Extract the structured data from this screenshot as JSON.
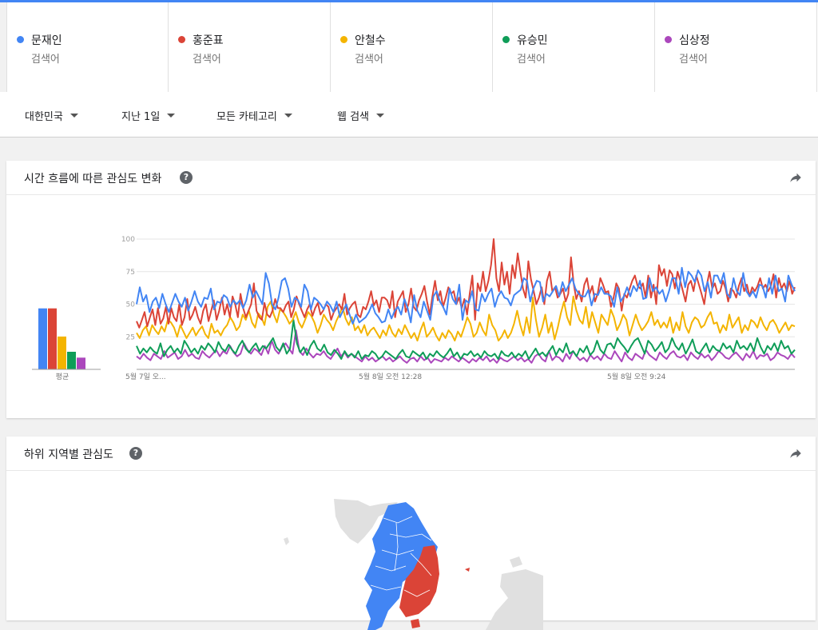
{
  "terms": [
    {
      "name": "문재인",
      "sub": "검색어",
      "color": "#4285f4"
    },
    {
      "name": "홍준표",
      "sub": "검색어",
      "color": "#db4437"
    },
    {
      "name": "안철수",
      "sub": "검색어",
      "color": "#f4b400"
    },
    {
      "name": "유승민",
      "sub": "검색어",
      "color": "#0f9d58"
    },
    {
      "name": "심상정",
      "sub": "검색어",
      "color": "#ab47bc"
    }
  ],
  "filters": {
    "region": "대한민국",
    "time": "지난 1일",
    "category": "모든 카테고리",
    "search_type": "웹 검색"
  },
  "interest_card": {
    "title": "시간 흐름에 따른 관심도 변화"
  },
  "region_card": {
    "title": "하위 지역별 관심도"
  },
  "help_glyph": "?",
  "chart_data": {
    "type": "line",
    "y_ticks": [
      100,
      75,
      50,
      25
    ],
    "ylim": [
      0,
      100
    ],
    "x_tick_labels": [
      "5월 7일 오...",
      "5월 8일 오전 12:28",
      "5월 8일 오전 9:24"
    ],
    "average_label": "평균",
    "averages": [
      {
        "name": "문재인",
        "value": 52
      },
      {
        "name": "홍준표",
        "value": 52
      },
      {
        "name": "안철수",
        "value": 28
      },
      {
        "name": "유승민",
        "value": 15
      },
      {
        "name": "심상정",
        "value": 10
      }
    ],
    "series": [
      {
        "name": "문재인",
        "color": "#4285f4",
        "values": [
          50,
          63,
          52,
          57,
          44,
          52,
          55,
          47,
          58,
          50,
          44,
          51,
          58,
          52,
          48,
          55,
          45,
          52,
          60,
          52,
          48,
          55,
          54,
          62,
          46,
          52,
          51,
          57,
          55,
          48,
          53,
          50,
          53,
          47,
          53,
          65,
          55,
          60,
          55,
          50,
          74,
          66,
          50,
          46,
          55,
          68,
          70,
          62,
          48,
          55,
          53,
          48,
          65,
          60,
          46,
          55,
          53,
          50,
          46,
          52,
          49,
          44,
          52,
          40,
          45,
          50,
          42,
          35,
          42,
          36,
          38,
          40,
          44,
          50,
          43,
          40,
          36,
          37,
          46,
          39,
          45,
          48,
          42,
          54,
          47,
          36,
          57,
          45,
          40,
          52,
          45,
          38,
          56,
          60,
          52,
          48,
          42,
          62,
          54,
          50,
          65,
          38,
          53,
          51,
          60,
          46,
          45,
          58,
          52,
          58,
          62,
          48,
          56,
          60,
          55,
          54,
          49,
          57,
          59,
          61,
          70,
          68,
          52,
          62,
          68,
          67,
          52,
          58,
          56,
          60,
          64,
          56,
          67,
          60,
          65,
          70,
          62,
          58,
          56,
          56,
          61,
          49,
          58,
          57,
          63,
          58,
          58,
          56,
          48,
          63,
          52,
          56,
          63,
          56,
          64,
          60,
          68,
          54,
          55,
          70,
          60,
          63,
          58,
          61,
          52,
          60,
          70,
          70,
          58,
          78,
          63,
          75,
          72,
          67,
          76,
          72,
          60,
          67,
          55,
          72,
          72,
          66,
          74,
          58,
          55,
          70,
          60,
          57,
          74,
          60,
          56,
          60,
          55,
          65,
          64,
          55,
          70,
          58,
          72,
          60,
          62,
          52,
          72,
          65,
          60
        ]
      },
      {
        "name": "홍준표",
        "color": "#db4437",
        "values": [
          37,
          32,
          38,
          44,
          33,
          40,
          46,
          34,
          47,
          35,
          39,
          48,
          35,
          47,
          40,
          37,
          50,
          34,
          40,
          54,
          38,
          42,
          48,
          40,
          35,
          45,
          50,
          37,
          45,
          53,
          38,
          45,
          55,
          42,
          50,
          40,
          56,
          50,
          40,
          58,
          47,
          40,
          45,
          50,
          66,
          45,
          40,
          38,
          51,
          42,
          40,
          45,
          54,
          47,
          47,
          44,
          49,
          52,
          40,
          46,
          56,
          50,
          45,
          40,
          46,
          50,
          41,
          47,
          51,
          42,
          45,
          50,
          48,
          38,
          44,
          47,
          50,
          46,
          58,
          42,
          47,
          50,
          52,
          42,
          40,
          48,
          46,
          52,
          60,
          49,
          53,
          44,
          55,
          55,
          53,
          47,
          60,
          40,
          52,
          56,
          60,
          44,
          50,
          62,
          48,
          45,
          53,
          58,
          64,
          52,
          42,
          56,
          68,
          53,
          60,
          48,
          55,
          63,
          58,
          60,
          50,
          55,
          47,
          54,
          42,
          58,
          72,
          38,
          66,
          60,
          75,
          60,
          68,
          80,
          100,
          70,
          60,
          82,
          65,
          75,
          58,
          80,
          70,
          89,
          75,
          62,
          55,
          83,
          69,
          60,
          50,
          55,
          63,
          50,
          68,
          75,
          60,
          63,
          55,
          58,
          62,
          52,
          58,
          86,
          66,
          54,
          60,
          52,
          65,
          70,
          58,
          64,
          52,
          58,
          70,
          65,
          59,
          60,
          48,
          55,
          66,
          62,
          45,
          58,
          55,
          62,
          68,
          72,
          64,
          62,
          66,
          55,
          72,
          55,
          65,
          50,
          80,
          72,
          77,
          64,
          76,
          73,
          62,
          75,
          68,
          60,
          52,
          65,
          68,
          60,
          72,
          65,
          58,
          50,
          65,
          75,
          62,
          66,
          58,
          60,
          68,
          62,
          52,
          62,
          60,
          55,
          64,
          70,
          60,
          65,
          56,
          63,
          60,
          64,
          70,
          62,
          65,
          60,
          64,
          73,
          55,
          70,
          62,
          66,
          60,
          68,
          58,
          63
        ]
      },
      {
        "name": "안철수",
        "color": "#f4b400",
        "values": [
          28,
          24,
          30,
          33,
          26,
          34,
          30,
          27,
          33,
          29,
          38,
          36,
          32,
          25,
          34,
          29,
          24,
          28,
          32,
          26,
          30,
          33,
          27,
          24,
          35,
          28,
          30,
          26,
          31,
          34,
          40,
          36,
          30,
          33,
          42,
          38,
          45,
          36,
          32,
          43,
          40,
          34,
          48,
          52,
          42,
          36,
          46,
          44,
          40,
          35,
          38,
          44,
          36,
          32,
          38,
          44,
          41,
          36,
          28,
          34,
          42,
          38,
          35,
          30,
          37,
          42,
          48,
          39,
          34,
          40,
          30,
          33,
          28,
          34,
          26,
          30,
          32,
          28,
          24,
          30,
          26,
          34,
          28,
          25,
          31,
          27,
          34,
          29,
          24,
          28,
          22,
          30,
          36,
          25,
          28,
          32,
          26,
          22,
          28,
          24,
          30,
          27,
          22,
          29,
          25,
          32,
          40,
          35,
          25,
          28,
          36,
          30,
          26,
          42,
          34,
          30,
          22,
          25,
          30,
          24,
          28,
          35,
          45,
          34,
          26,
          40,
          28,
          55,
          38,
          25,
          32,
          42,
          28,
          36,
          23,
          32,
          43,
          52,
          40,
          34,
          56,
          45,
          38,
          35,
          48,
          32,
          44,
          36,
          28,
          42,
          38,
          34,
          46,
          40,
          30,
          35,
          42,
          38,
          26,
          34,
          42,
          35,
          30,
          33,
          37,
          44,
          34,
          38,
          32,
          36,
          32,
          40,
          28,
          36,
          30,
          44,
          33,
          28,
          36,
          40,
          38,
          32,
          34,
          40,
          44,
          35,
          36,
          28,
          34,
          30,
          42,
          32,
          36,
          40,
          28,
          34,
          30,
          38,
          36,
          32,
          40,
          34,
          30,
          36,
          38,
          34,
          28,
          32,
          36,
          30,
          34,
          33
        ]
      },
      {
        "name": "유승민",
        "color": "#0f9d58",
        "values": [
          18,
          12,
          16,
          13,
          17,
          14,
          12,
          20,
          10,
          15,
          18,
          13,
          16,
          12,
          22,
          18,
          13,
          16,
          12,
          18,
          15,
          20,
          17,
          13,
          21,
          16,
          14,
          19,
          15,
          12,
          18,
          22,
          16,
          13,
          17,
          20,
          14,
          18,
          16,
          20,
          24,
          17,
          14,
          20,
          12,
          16,
          38,
          20,
          13,
          17,
          11,
          18,
          22,
          16,
          14,
          19,
          13,
          11,
          15,
          12,
          8,
          14,
          10,
          12,
          9,
          14,
          8,
          11,
          10,
          14,
          12,
          8,
          10,
          14,
          12,
          10,
          8,
          12,
          15,
          10,
          9,
          14,
          12,
          10,
          13,
          8,
          12,
          10,
          14,
          11,
          9,
          12,
          16,
          10,
          13,
          8,
          12,
          11,
          14,
          10,
          12,
          9,
          14,
          11,
          10,
          12,
          8,
          14,
          11,
          10,
          13,
          9,
          12,
          10,
          14,
          8,
          12,
          16,
          11,
          13,
          10,
          14,
          18,
          11,
          16,
          13,
          20,
          12,
          14,
          10,
          16,
          13,
          18,
          11,
          14,
          22,
          15,
          12,
          19,
          20,
          16,
          24,
          20,
          17,
          13,
          18,
          22,
          24,
          18,
          12,
          22,
          19,
          14,
          17,
          21,
          13,
          16,
          24,
          18,
          15,
          20,
          12,
          17,
          23,
          14,
          12,
          16,
          20,
          13,
          18,
          15,
          14,
          20,
          16,
          18,
          13,
          22,
          16,
          18,
          15,
          20,
          14,
          24,
          17,
          12,
          18,
          15,
          20,
          14,
          22,
          16,
          18,
          12,
          15
        ]
      },
      {
        "name": "심상정",
        "color": "#ab47bc",
        "values": [
          10,
          8,
          12,
          9,
          7,
          12,
          10,
          8,
          14,
          9,
          11,
          13,
          8,
          10,
          15,
          10,
          12,
          9,
          8,
          14,
          11,
          9,
          12,
          15,
          10,
          14,
          12,
          18,
          13,
          10,
          12,
          20,
          15,
          12,
          16,
          14,
          11,
          18,
          12,
          22,
          15,
          12,
          17,
          20,
          16,
          12,
          30,
          14,
          11,
          16,
          12,
          9,
          12,
          11,
          14,
          10,
          8,
          12,
          16,
          10,
          13,
          9,
          12,
          10,
          8,
          6,
          10,
          7,
          9,
          6,
          8,
          10,
          7,
          9,
          6,
          8,
          10,
          7,
          5,
          8,
          9,
          6,
          10,
          7,
          9,
          5,
          8,
          7,
          6,
          9,
          7,
          10,
          8,
          6,
          9,
          7,
          5,
          8,
          6,
          9,
          7,
          10,
          6,
          8,
          5,
          9,
          7,
          6,
          8,
          10,
          7,
          9,
          6,
          8,
          5,
          10,
          12,
          8,
          6,
          14,
          7,
          10,
          9,
          6,
          12,
          8,
          14,
          10,
          7,
          9,
          6,
          11,
          8,
          10,
          7,
          12,
          9,
          8,
          14,
          10,
          6,
          13,
          9,
          7,
          12,
          10,
          8,
          15,
          11,
          9,
          7,
          13,
          10,
          8,
          12,
          14,
          10,
          9,
          11,
          7,
          13,
          10,
          8,
          12,
          9,
          11,
          7,
          10,
          14,
          12,
          9,
          8,
          11,
          13,
          10,
          7,
          12,
          9,
          14,
          8,
          11,
          10,
          12,
          7,
          9,
          13,
          11,
          10,
          8,
          12,
          9
        ]
      }
    ]
  }
}
